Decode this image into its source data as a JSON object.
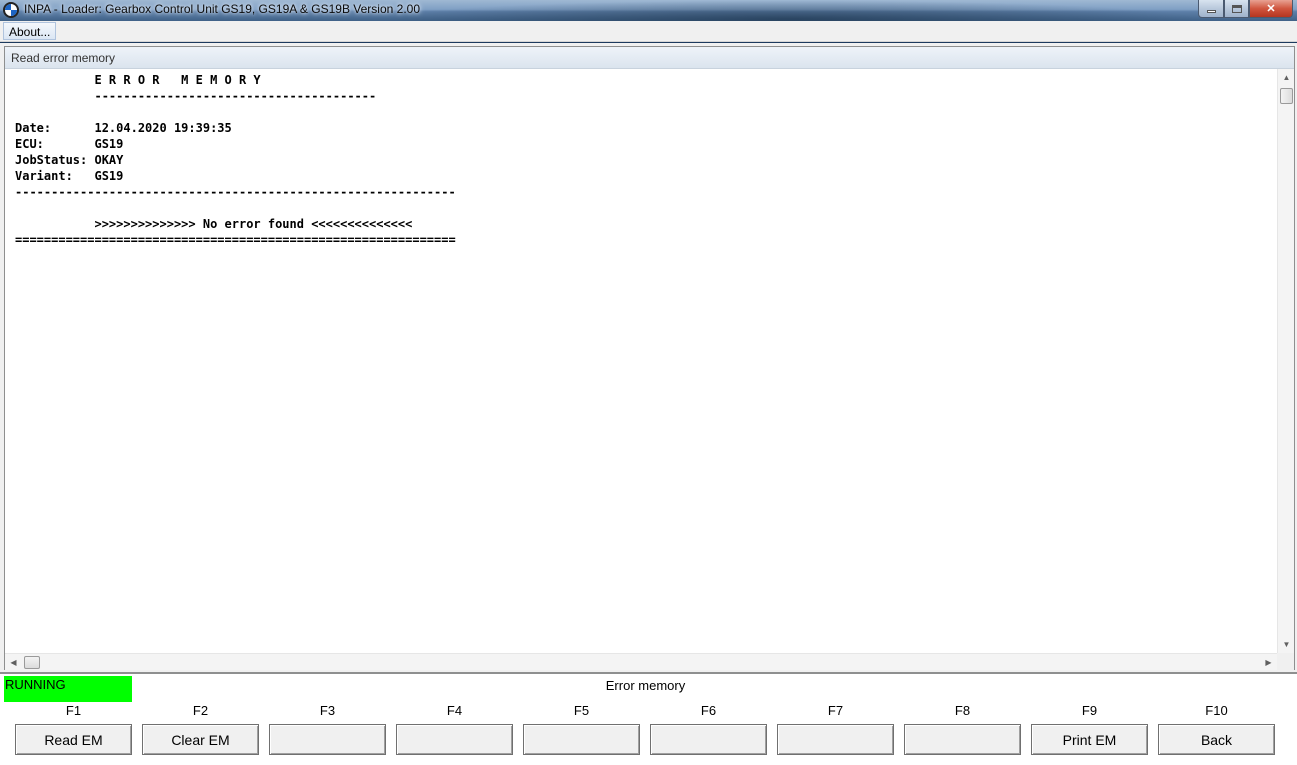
{
  "window": {
    "title": "INPA - Loader:  Gearbox Control Unit GS19, GS19A & GS19B Version 2.00"
  },
  "menu": {
    "items": [
      "About..."
    ]
  },
  "panel": {
    "title": "Read error memory",
    "lines": [
      "           E R R O R   M E M O R Y",
      "           ---------------------------------------",
      "",
      "Date:      12.04.2020 19:39:35",
      "ECU:       GS19",
      "JobStatus: OKAY",
      "Variant:   GS19",
      "-------------------------------------------------------------",
      "",
      "           >>>>>>>>>>>>>> No error found <<<<<<<<<<<<<<",
      "============================================================="
    ]
  },
  "status": {
    "state": "RUNNING",
    "state_color": "#00ff00",
    "screen_title": "Error memory"
  },
  "fkeys": [
    {
      "key": "F1",
      "label": "Read EM"
    },
    {
      "key": "F2",
      "label": "Clear EM"
    },
    {
      "key": "F3",
      "label": ""
    },
    {
      "key": "F4",
      "label": ""
    },
    {
      "key": "F5",
      "label": ""
    },
    {
      "key": "F6",
      "label": ""
    },
    {
      "key": "F7",
      "label": ""
    },
    {
      "key": "F8",
      "label": ""
    },
    {
      "key": "F9",
      "label": "Print EM"
    },
    {
      "key": "F10",
      "label": "Back"
    }
  ]
}
